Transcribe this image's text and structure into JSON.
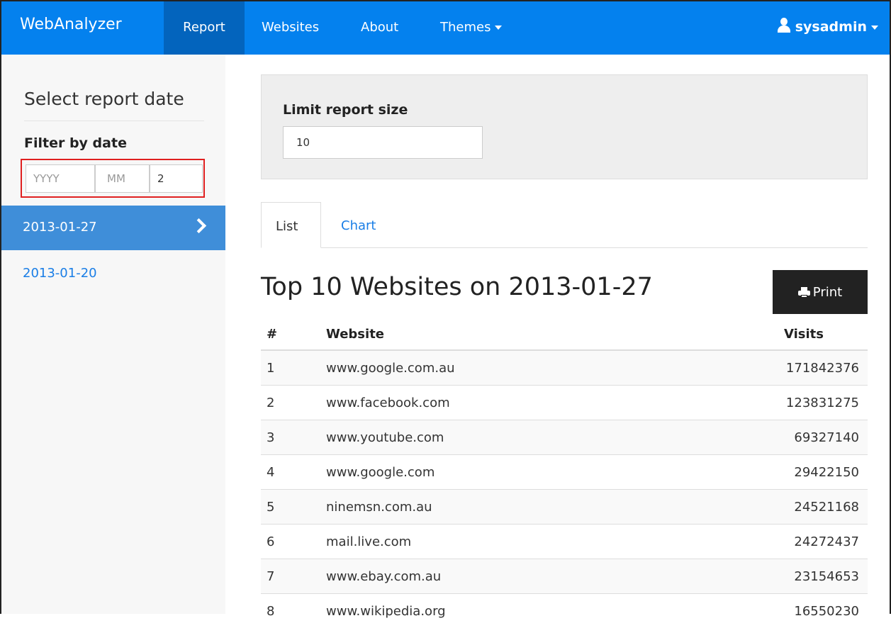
{
  "navbar": {
    "brand": "WebAnalyzer",
    "items": [
      {
        "label": "Report"
      },
      {
        "label": "Websites"
      },
      {
        "label": "About"
      },
      {
        "label": "Themes"
      }
    ],
    "user": "sysadmin",
    "colors": {
      "bar": "#0481ee",
      "active": "#0364bd"
    }
  },
  "sidebar": {
    "title": "Select report date",
    "filter_label": "Filter by date",
    "filter": {
      "year_placeholder": "YYYY",
      "month_placeholder": "MM",
      "day_value": "2"
    },
    "dates": [
      {
        "label": "2013-01-27",
        "active": true
      },
      {
        "label": "2013-01-20",
        "active": false
      }
    ]
  },
  "main": {
    "limit_label": "Limit report size",
    "limit_value": "10",
    "tabs": [
      {
        "label": "List",
        "active": true
      },
      {
        "label": "Chart",
        "active": false
      }
    ],
    "report_title": "Top 10 Websites on 2013-01-27",
    "print_label": "Print",
    "table": {
      "headers": {
        "num": "#",
        "site": "Website",
        "visits": "Visits"
      },
      "rows": [
        {
          "num": "1",
          "site": "www.google.com.au",
          "visits": "171842376"
        },
        {
          "num": "2",
          "site": "www.facebook.com",
          "visits": "123831275"
        },
        {
          "num": "3",
          "site": "www.youtube.com",
          "visits": "69327140"
        },
        {
          "num": "4",
          "site": "www.google.com",
          "visits": "29422150"
        },
        {
          "num": "5",
          "site": "ninemsn.com.au",
          "visits": "24521168"
        },
        {
          "num": "6",
          "site": "mail.live.com",
          "visits": "24272437"
        },
        {
          "num": "7",
          "site": "www.ebay.com.au",
          "visits": "23154653"
        },
        {
          "num": "8",
          "site": "www.wikipedia.org",
          "visits": "16550230"
        }
      ]
    }
  }
}
